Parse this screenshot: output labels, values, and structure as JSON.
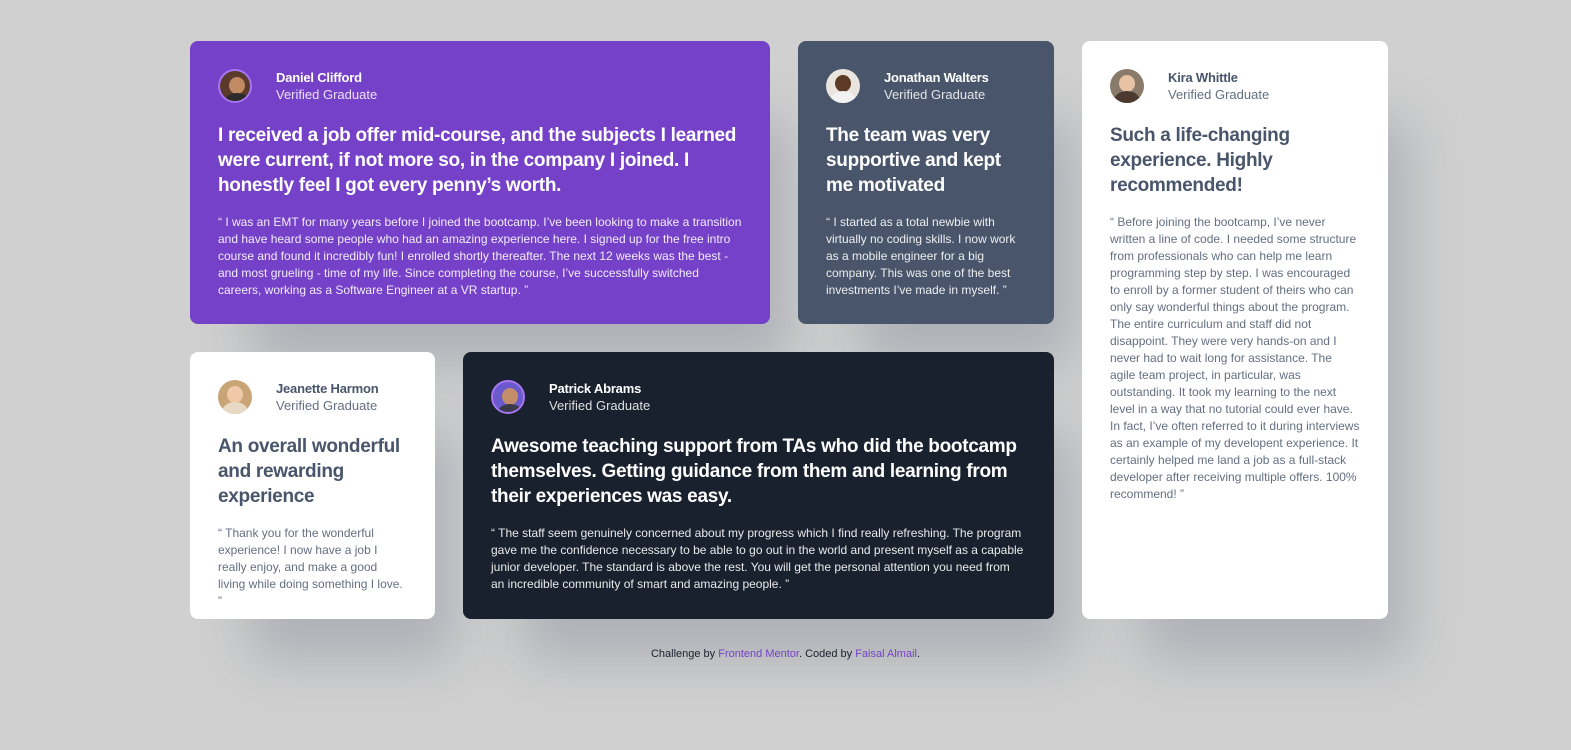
{
  "testimonials": [
    {
      "name": "Daniel Clifford",
      "role": "Verified Graduate",
      "headline": "I received a job offer mid-course, and the subjects I learned were current, if not more so, in the company I joined. I honestly feel I got every penny’s worth.",
      "quote": "“ I was an EMT for many years before I joined the bootcamp. I’ve been looking to make a transition and have heard some people who had an amazing experience here. I signed up for the free intro course and found it incredibly fun! I enrolled shortly thereafter. The next 12 weeks was the best - and most grueling - time of my life. Since completing the course, I’ve successfully switched careers, working as a Software Engineer at a VR startup. ”",
      "card_color": "#7541c8"
    },
    {
      "name": "Jonathan Walters",
      "role": "Verified Graduate",
      "headline": "The team was very supportive and kept me motivated",
      "quote": "“ I started as a total newbie with virtually no coding skills. I now work as a mobile engineer for a big company. This was one of the best investments I’ve made in myself. ”",
      "card_color": "#48556a"
    },
    {
      "name": "Jeanette Harmon",
      "role": "Verified Graduate",
      "headline": "An overall wonderful and rewarding experience",
      "quote": "“ Thank you for the wonderful experience! I now have a job I really enjoy, and make a good living while doing something I love. ”",
      "card_color": "#ffffff"
    },
    {
      "name": "Patrick Abrams",
      "role": "Verified Graduate",
      "headline": "Awesome teaching support from TAs who did the bootcamp themselves. Getting guidance from them and learning from their experiences was easy.",
      "quote": "“ The staff seem genuinely concerned about my progress which I find really refreshing. The program gave me the confidence necessary to be able to go out in the world and present myself as a capable junior developer. The standard is above the rest. You will get the personal attention you need from an incredible community of smart and amazing people. ”",
      "card_color": "#19212e"
    },
    {
      "name": "Kira Whittle",
      "role": "Verified Graduate",
      "headline": "Such a life-changing experience. Highly recommended!",
      "quote": "“ Before joining the bootcamp, I’ve never written a line of code. I needed some structure from professionals who can help me learn programming step by step. I was encouraged to enroll by a former student of theirs who can only say wonderful things about the program. The entire curriculum and staff did not disappoint. They were very hands-on and I never had to wait long for assistance. The agile team project, in particular, was outstanding. It took my learning to the next level in a way that no tutorial could ever have. In fact, I’ve often referred to it during interviews as an example of my developent experience. It certainly helped me land a job as a full-stack developer after receiving multiple offers. 100% recommend! ”",
      "card_color": "#ffffff"
    }
  ],
  "footer": {
    "prefix": "Challenge by ",
    "link1": "Frontend Mentor",
    "middle": ". Coded by ",
    "link2": "Faisal Almail",
    "suffix": "."
  },
  "colors": {
    "background": "#d0d0d0",
    "accent": "#7541c8",
    "link": "#7541c8"
  }
}
